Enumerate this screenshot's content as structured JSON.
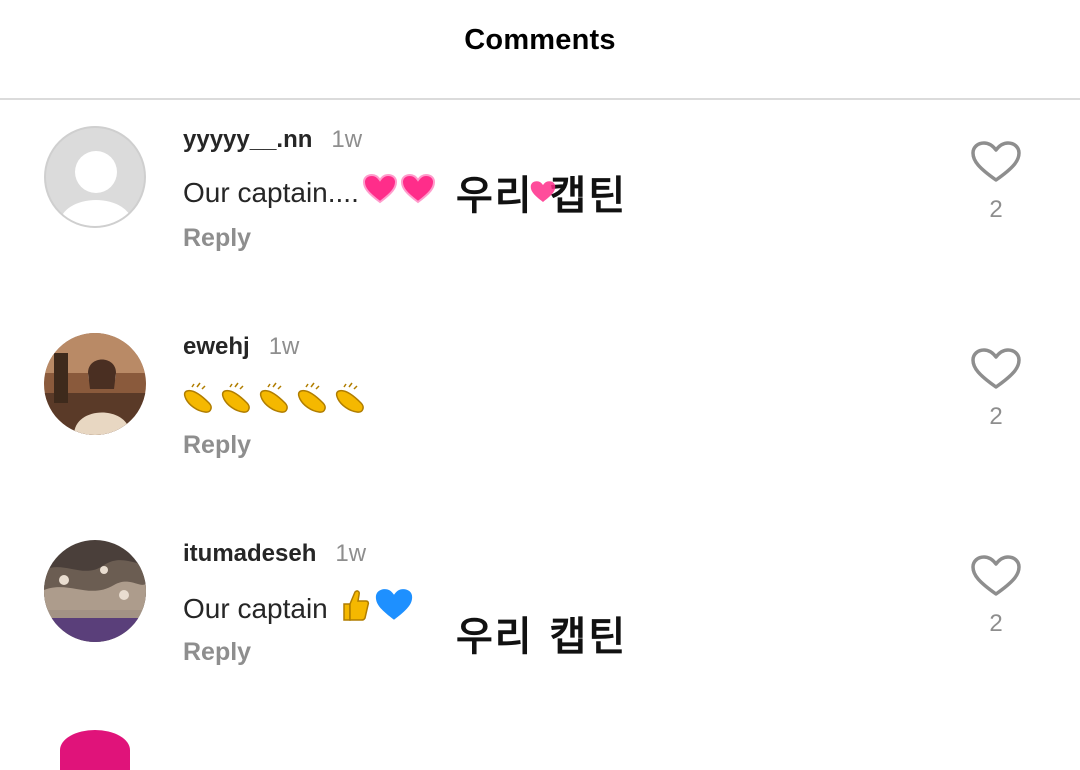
{
  "header": {
    "title": "Comments"
  },
  "comments": [
    {
      "username": "yyyyy__.nn",
      "time": "1w",
      "text": "Our captain....",
      "reply_label": "Reply",
      "like_count": "2",
      "avatar": "default-avatar",
      "emojis": [
        "pink-heart-icon",
        "pink-heart-icon",
        "pink-heart-icon"
      ]
    },
    {
      "username": "ewehj",
      "time": "1w",
      "text": "",
      "reply_label": "Reply",
      "like_count": "2",
      "avatar": "photo-avatar",
      "emojis": [
        "clapping-hands-icon",
        "clapping-hands-icon",
        "clapping-hands-icon",
        "clapping-hands-icon",
        "clapping-hands-icon"
      ]
    },
    {
      "username": "itumadeseh",
      "time": "1w",
      "text": "Our captain",
      "reply_label": "Reply",
      "like_count": "2",
      "avatar": "photo-avatar",
      "emojis": [
        "thumbs-up-icon",
        "blue-heart-icon"
      ]
    }
  ],
  "overlays": [
    "우리 캡틴",
    "우리 캡틴"
  ],
  "colors": {
    "text": "#262626",
    "secondary": "#8e8e8e",
    "divider": "#dbdbdb",
    "pink": "#ff2d8a",
    "blue": "#1e90ff",
    "clap": "#f5b800"
  }
}
